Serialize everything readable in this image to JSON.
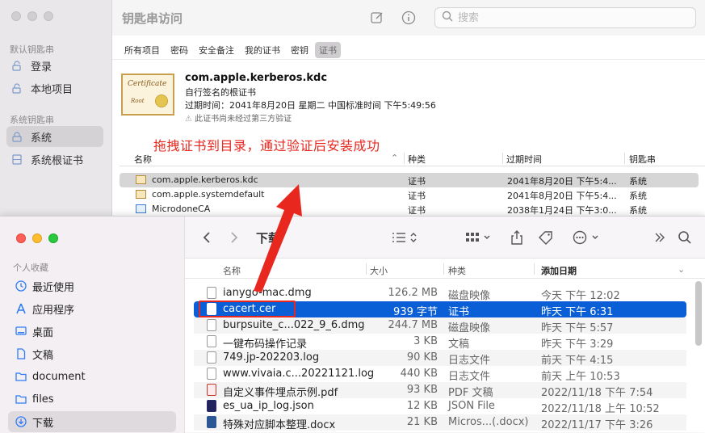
{
  "keychain": {
    "title": "钥匙串访问",
    "search_placeholder": "搜索",
    "sidebar": {
      "default_header": "默认钥匙串",
      "default_items": [
        {
          "label": "登录"
        },
        {
          "label": "本地项目"
        }
      ],
      "system_header": "系统钥匙串",
      "system_items": [
        {
          "label": "系统"
        },
        {
          "label": "系统根证书"
        }
      ]
    },
    "tabs": [
      "所有项目",
      "密码",
      "安全备注",
      "我的证书",
      "密钥",
      "证书"
    ],
    "selected_tab": "证书",
    "detail": {
      "image_title": "Certificate",
      "image_subtitle": "Root",
      "name": "com.apple.kerberos.kdc",
      "subtitle": "自行签名的根证书",
      "expiry": "过期时间：2041年8月20日 星期二 中国标准时间 下午5:49:56",
      "warning": "此证书尚未经过第三方验证"
    },
    "table": {
      "headers": [
        "名称",
        "种类",
        "过期时间",
        "钥匙串"
      ],
      "rows": [
        {
          "name": "com.apple.kerberos.kdc",
          "kind": "证书",
          "expires": "2041年8月20日 下午5:4...",
          "keychain": "系统"
        },
        {
          "name": "com.apple.systemdefault",
          "kind": "证书",
          "expires": "2041年8月20日 下午5:4...",
          "keychain": "系统"
        },
        {
          "name": "MicrodoneCA",
          "kind": "证书",
          "expires": "2038年1月24日 下午3:0...",
          "keychain": "系统"
        }
      ]
    }
  },
  "annotation": "拖拽证书到目录，通过验证后安装成功",
  "finder": {
    "title": "下载",
    "sidebar_header": "个人收藏",
    "sidebar_items": [
      {
        "label": "最近使用",
        "icon": "clock-icon"
      },
      {
        "label": "应用程序",
        "icon": "apps-icon"
      },
      {
        "label": "桌面",
        "icon": "desktop-icon"
      },
      {
        "label": "文稿",
        "icon": "document-icon"
      },
      {
        "label": "document",
        "icon": "folder-icon"
      },
      {
        "label": "files",
        "icon": "folder-icon"
      },
      {
        "label": "下载",
        "icon": "download-icon"
      }
    ],
    "columns": [
      "名称",
      "大小",
      "种类",
      "添加日期"
    ],
    "files": [
      {
        "name": "ianygo-mac.dmg",
        "size": "126.2 MB",
        "kind": "磁盘映像",
        "date": "今天 下午 12:02"
      },
      {
        "name": "cacert.cer",
        "size": "939 字节",
        "kind": "证书",
        "date": "昨天 下午 6:31"
      },
      {
        "name": "burpsuite_c...022_9_6.dmg",
        "size": "244.7 MB",
        "kind": "磁盘映像",
        "date": "昨天 下午 5:57"
      },
      {
        "name": "一键布码操作记录",
        "size": "3 KB",
        "kind": "文稿",
        "date": "昨天 下午 3:29"
      },
      {
        "name": "749.jp-202203.log",
        "size": "90 KB",
        "kind": "日志文件",
        "date": "前天 下午 4:15"
      },
      {
        "name": "www.vivaia.c...20221121.log",
        "size": "440 KB",
        "kind": "日志文件",
        "date": "前天 上午 10:53"
      },
      {
        "name": "自定义事件埋点示例.pdf",
        "size": "93 KB",
        "kind": "PDF 文稿",
        "date": "2022/11/18 下午 7:54"
      },
      {
        "name": "es_ua_ip_log.json",
        "size": "12 KB",
        "kind": "JSON File",
        "date": "2022/11/18 上午 10:52"
      },
      {
        "name": "特殊对应脚本整理.docx",
        "size": "21 KB",
        "kind": "Micros...(.docx)",
        "date": "2022/11/17 下午 3:26"
      }
    ]
  },
  "colors": {
    "selection": "#0a5fd6",
    "annotation": "#e8271f"
  }
}
